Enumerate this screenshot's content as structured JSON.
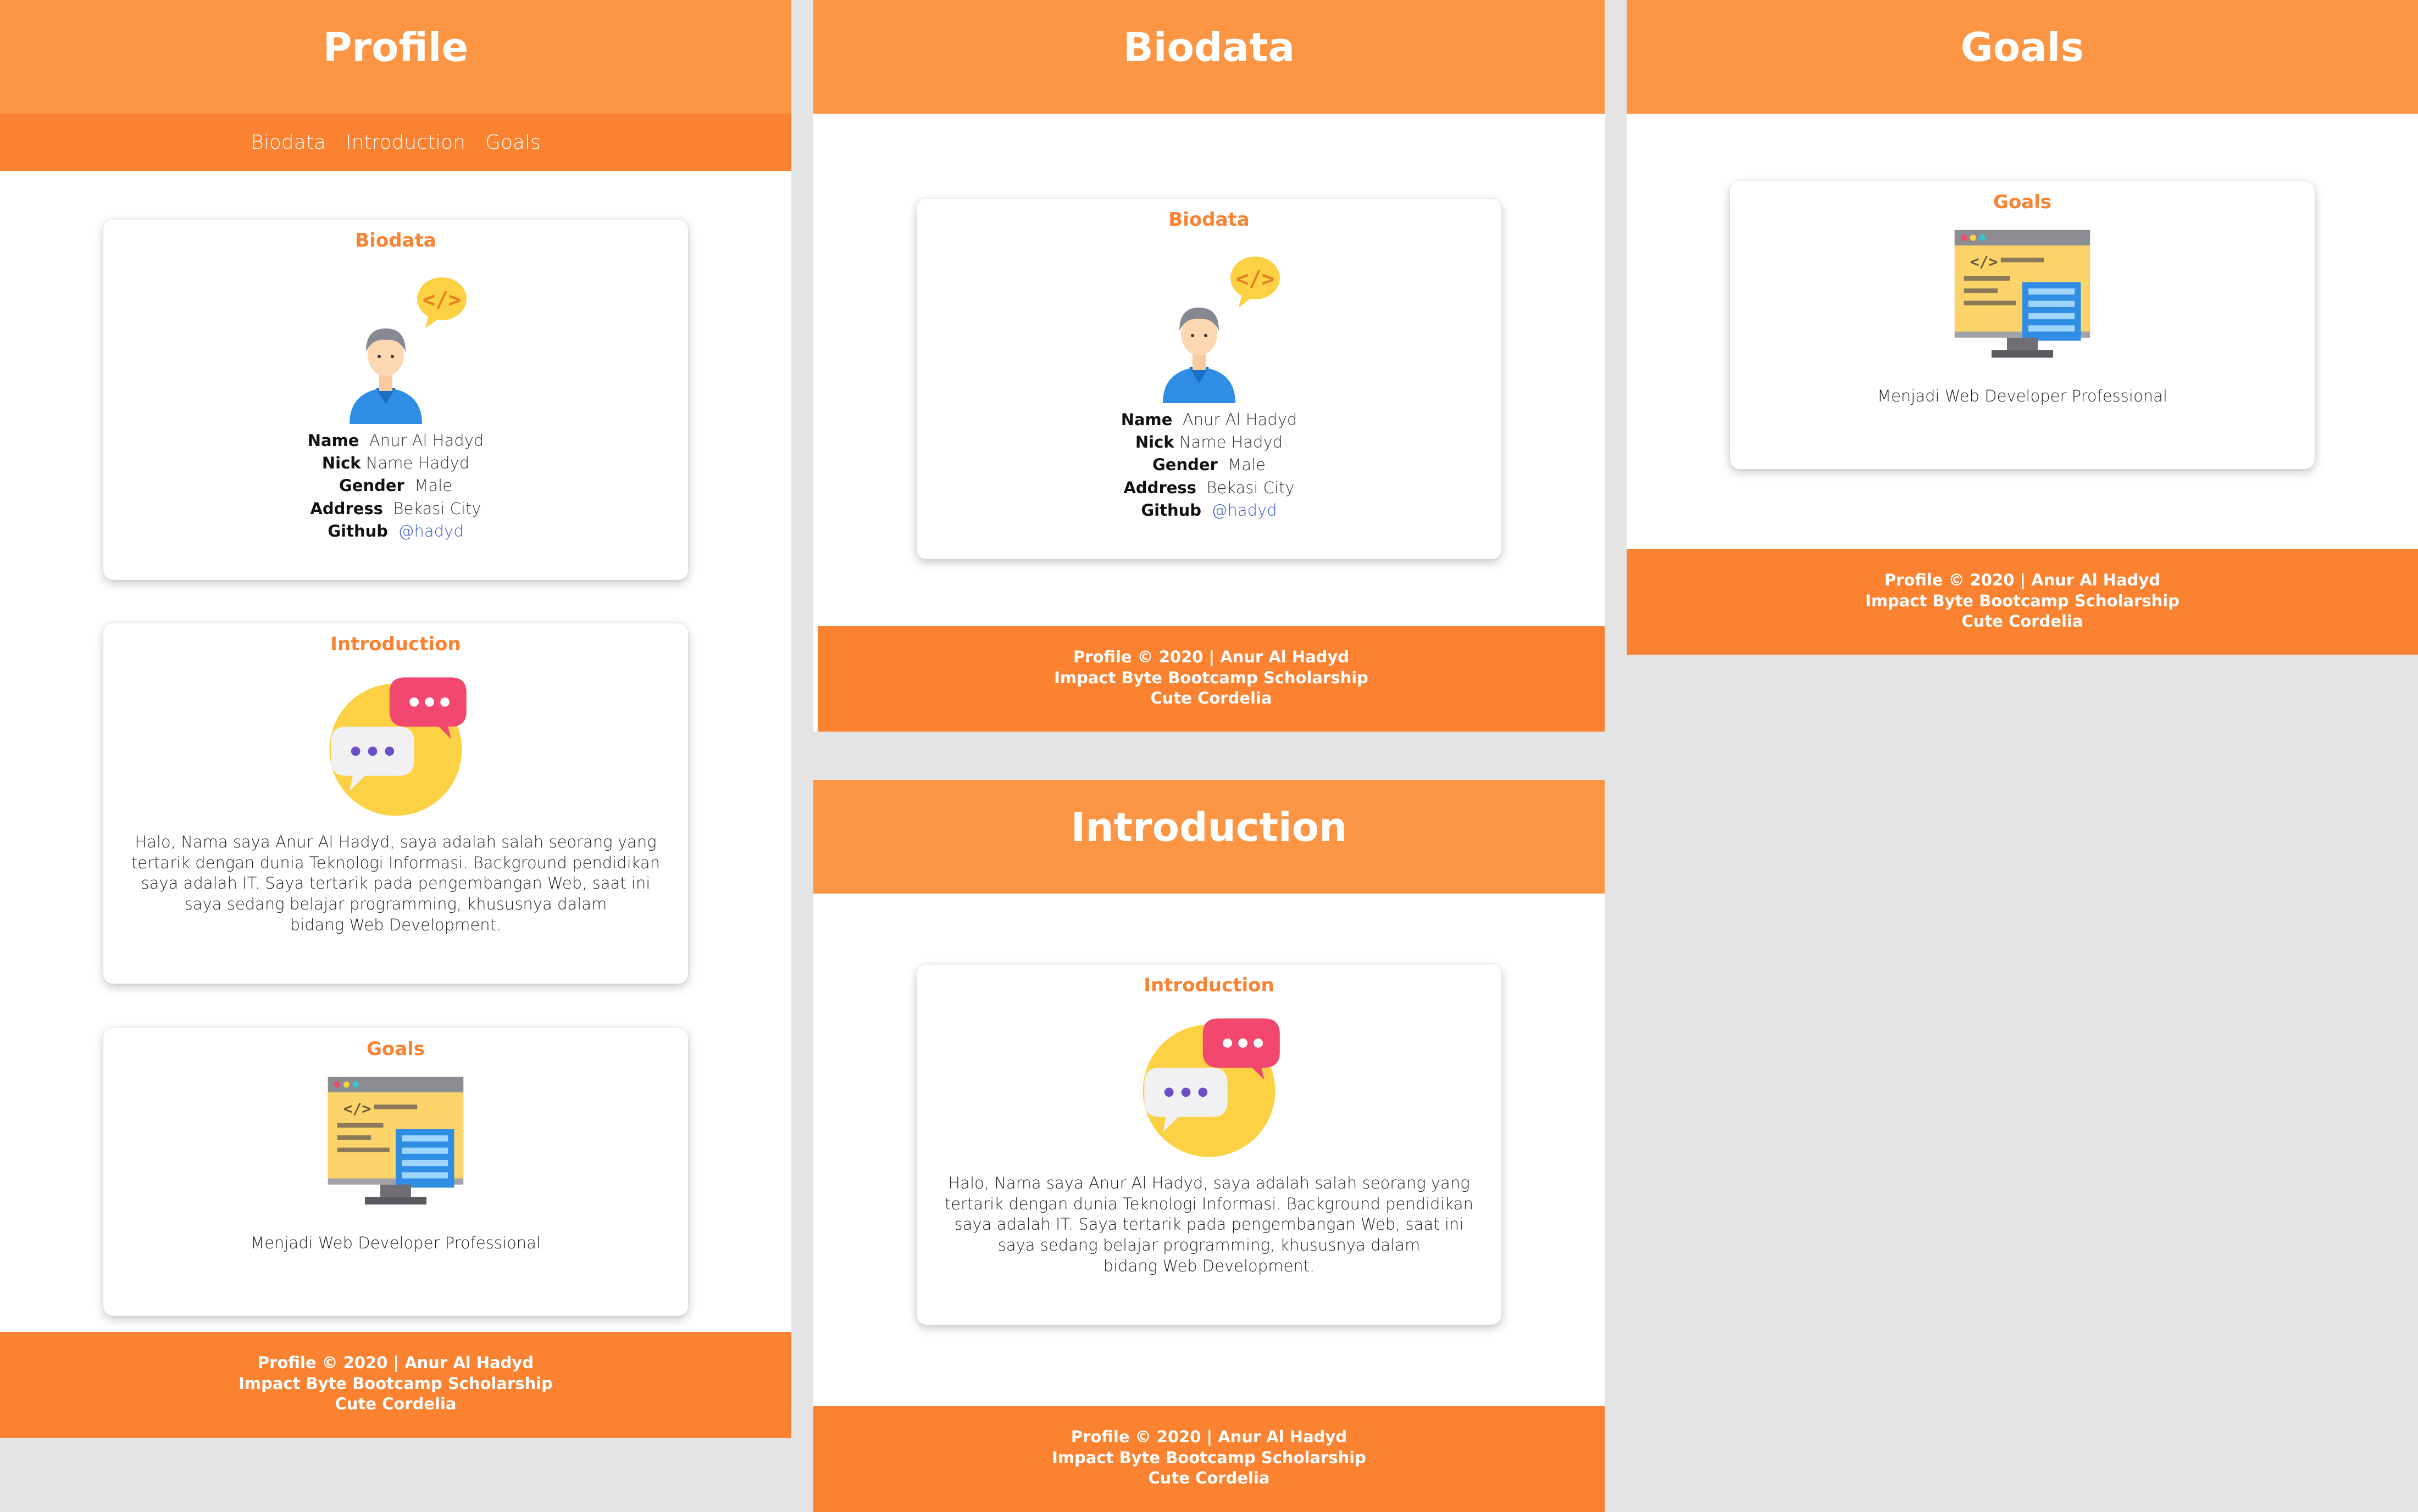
{
  "profile_page": {
    "header_title": "Profile",
    "nav": [
      "Biodata",
      "Introduction",
      "Goals"
    ]
  },
  "biodata_page": {
    "header_title": "Biodata"
  },
  "goals_page": {
    "header_title": "Goals"
  },
  "introduction_page": {
    "header_title": "Introduction"
  },
  "biodata_card": {
    "title": "Biodata",
    "illustration": "developer-avatar-icon",
    "rows": [
      {
        "label": "Name",
        "value": "Anur Al Hadyd"
      },
      {
        "label": "Nick",
        "value": "Name  Hadyd"
      },
      {
        "label": "Gender",
        "value": "Male"
      },
      {
        "label": "Address",
        "value": "Bekasi City"
      },
      {
        "label": "Github",
        "value": "@hadyd"
      }
    ]
  },
  "introduction_card": {
    "title": "Introduction",
    "illustration": "chat-bubbles-icon",
    "text_lines": [
      "Halo, Nama saya Anur Al Hadyd, saya adalah salah seorang yang",
      "tertarik dengan dunia Teknologi Informasi. Background pendidikan",
      "saya adalah IT.  Saya tertarik pada pengembangan Web, saat ini",
      "saya sedang belajar programming, khususnya dalam",
      "bidang Web Development."
    ]
  },
  "goals_card": {
    "title": "Goals",
    "illustration": "code-monitor-icon",
    "text": "Menjadi Web Developer Professional"
  },
  "footer": {
    "line1": "Profile © 2020 | Anur Al Hadyd",
    "line2": "Impact Byte Bootcamp Scholarship",
    "line3": "Cute Cordelia"
  },
  "colors": {
    "header": "#fd9644",
    "nav_and_footer": "#fa8231",
    "accent_text": "#fa8231",
    "background": "#e4e4e4",
    "link": "#3b5ccc"
  }
}
